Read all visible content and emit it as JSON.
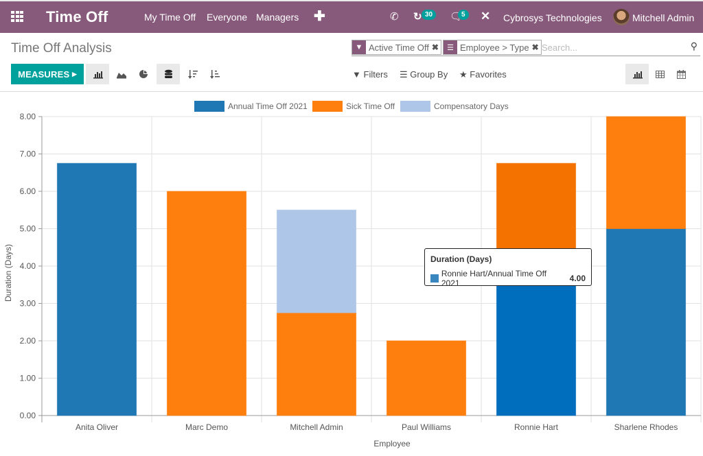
{
  "navbar": {
    "app_title": "Time Off",
    "menus": [
      "My Time Off",
      "Everyone",
      "Managers"
    ],
    "plus": "✚",
    "activity_badge": "30",
    "messages_badge": "5",
    "company": "Cybrosys Technologies",
    "user": "Mitchell Admin",
    "color": "#875a7b"
  },
  "control_panel": {
    "breadcrumb": "Time Off Analysis",
    "facets": [
      {
        "icon": "filter-icon",
        "label": "Active Time Off"
      },
      {
        "icon": "group-icon",
        "label": "Employee > Type"
      }
    ],
    "search_placeholder": "Search...",
    "measures_label": "MEASURES",
    "search_options": {
      "filters": "Filters",
      "group_by": "Group By",
      "favorites": "Favorites"
    },
    "accent": "#00a09d"
  },
  "tooltip": {
    "title": "Duration (Days)",
    "label": "Ronnie Hart/Annual Time Off 2021",
    "value": "4.00"
  },
  "chart_data": {
    "type": "bar",
    "stacked": true,
    "title": "",
    "xlabel": "Employee",
    "ylabel": "Duration (Days)",
    "ylim": [
      0,
      8
    ],
    "yticks": [
      "0.00",
      "1.00",
      "2.00",
      "3.00",
      "4.00",
      "5.00",
      "6.00",
      "7.00",
      "8.00"
    ],
    "grid": true,
    "legend_position": "top-center",
    "categories": [
      "Anita Oliver",
      "Marc Demo",
      "Mitchell Admin",
      "Paul Williams",
      "Ronnie Hart",
      "Sharlene Rhodes"
    ],
    "series": [
      {
        "name": "Annual Time Off 2021",
        "color": "#1f77b4",
        "values": [
          6.75,
          0,
          0,
          0,
          4,
          5
        ]
      },
      {
        "name": "Sick Time Off",
        "color": "#ff7f0e",
        "values": [
          0,
          6,
          2.75,
          2,
          2.75,
          3
        ]
      },
      {
        "name": "Compensatory Days",
        "color": "#aec7e8",
        "values": [
          0,
          0,
          2.75,
          0,
          0,
          0
        ]
      }
    ]
  }
}
